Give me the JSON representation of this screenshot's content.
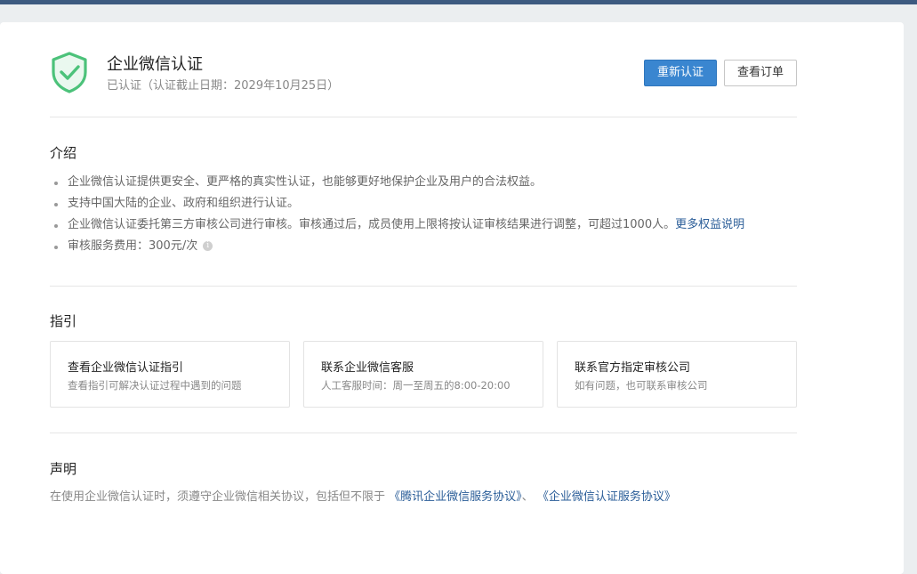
{
  "header": {
    "title": "企业微信认证",
    "subtitle": "已认证（认证截止日期：2029年10月25日）",
    "recertify_label": "重新认证",
    "view_order_label": "查看订单",
    "shield_color": "#4cc27a"
  },
  "intro": {
    "title": "介绍",
    "items": [
      "企业微信认证提供更安全、更严格的真实性认证，也能够更好地保护企业及用户的合法权益。",
      "支持中国大陆的企业、政府和组织进行认证。",
      "企业微信认证委托第三方审核公司进行审核。审核通过后，成员使用上限将按认证审核结果进行调整，可超过1000人。",
      "审核服务费用：300元/次"
    ],
    "more_link": "更多权益说明"
  },
  "guide": {
    "title": "指引",
    "boxes": [
      {
        "title": "查看企业微信认证指引",
        "desc": "查看指引可解决认证过程中遇到的问题"
      },
      {
        "title": "联系企业微信客服",
        "desc": "人工客服时间：周一至周五的8:00-20:00"
      },
      {
        "title": "联系官方指定审核公司",
        "desc": "如有问题，也可联系审核公司"
      }
    ]
  },
  "statement": {
    "title": "声明",
    "text": "在使用企业微信认证时，须遵守企业微信相关协议，包括但不限于",
    "link1": "《腾讯企业微信服务协议》",
    "separator": "、",
    "link2": "《企业微信认证服务协议》"
  },
  "colors": {
    "primary": "#3a86d0",
    "link": "#2a5d98",
    "topbar": "#3d5a80"
  }
}
